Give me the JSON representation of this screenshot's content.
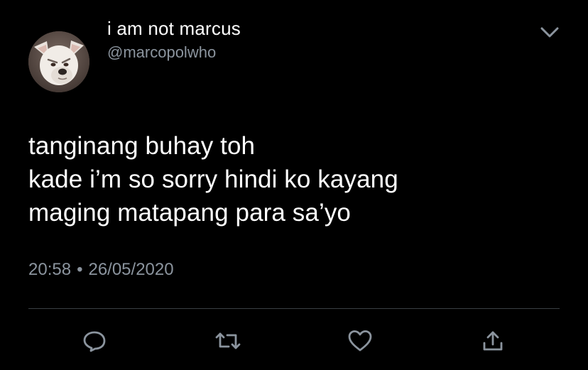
{
  "user": {
    "display_name": "i am not marcus",
    "handle": "@marcopolwho",
    "avatar_icon": "dog-avatar"
  },
  "tweet": {
    "lines": [
      "tanginang buhay toh",
      "kade i’m so sorry hindi ko kayang",
      "maging matapang para sa’yo"
    ],
    "time": "20:58",
    "separator": "•",
    "date": "26/05/2020"
  },
  "actions": {
    "reply_icon": "reply-icon",
    "retweet_icon": "retweet-icon",
    "like_icon": "heart-icon",
    "share_icon": "share-icon"
  },
  "colors": {
    "background": "#000000",
    "text_primary": "#ffffff",
    "text_secondary": "#8b949e",
    "icon": "#8b949e",
    "divider": "#3a3f44"
  }
}
